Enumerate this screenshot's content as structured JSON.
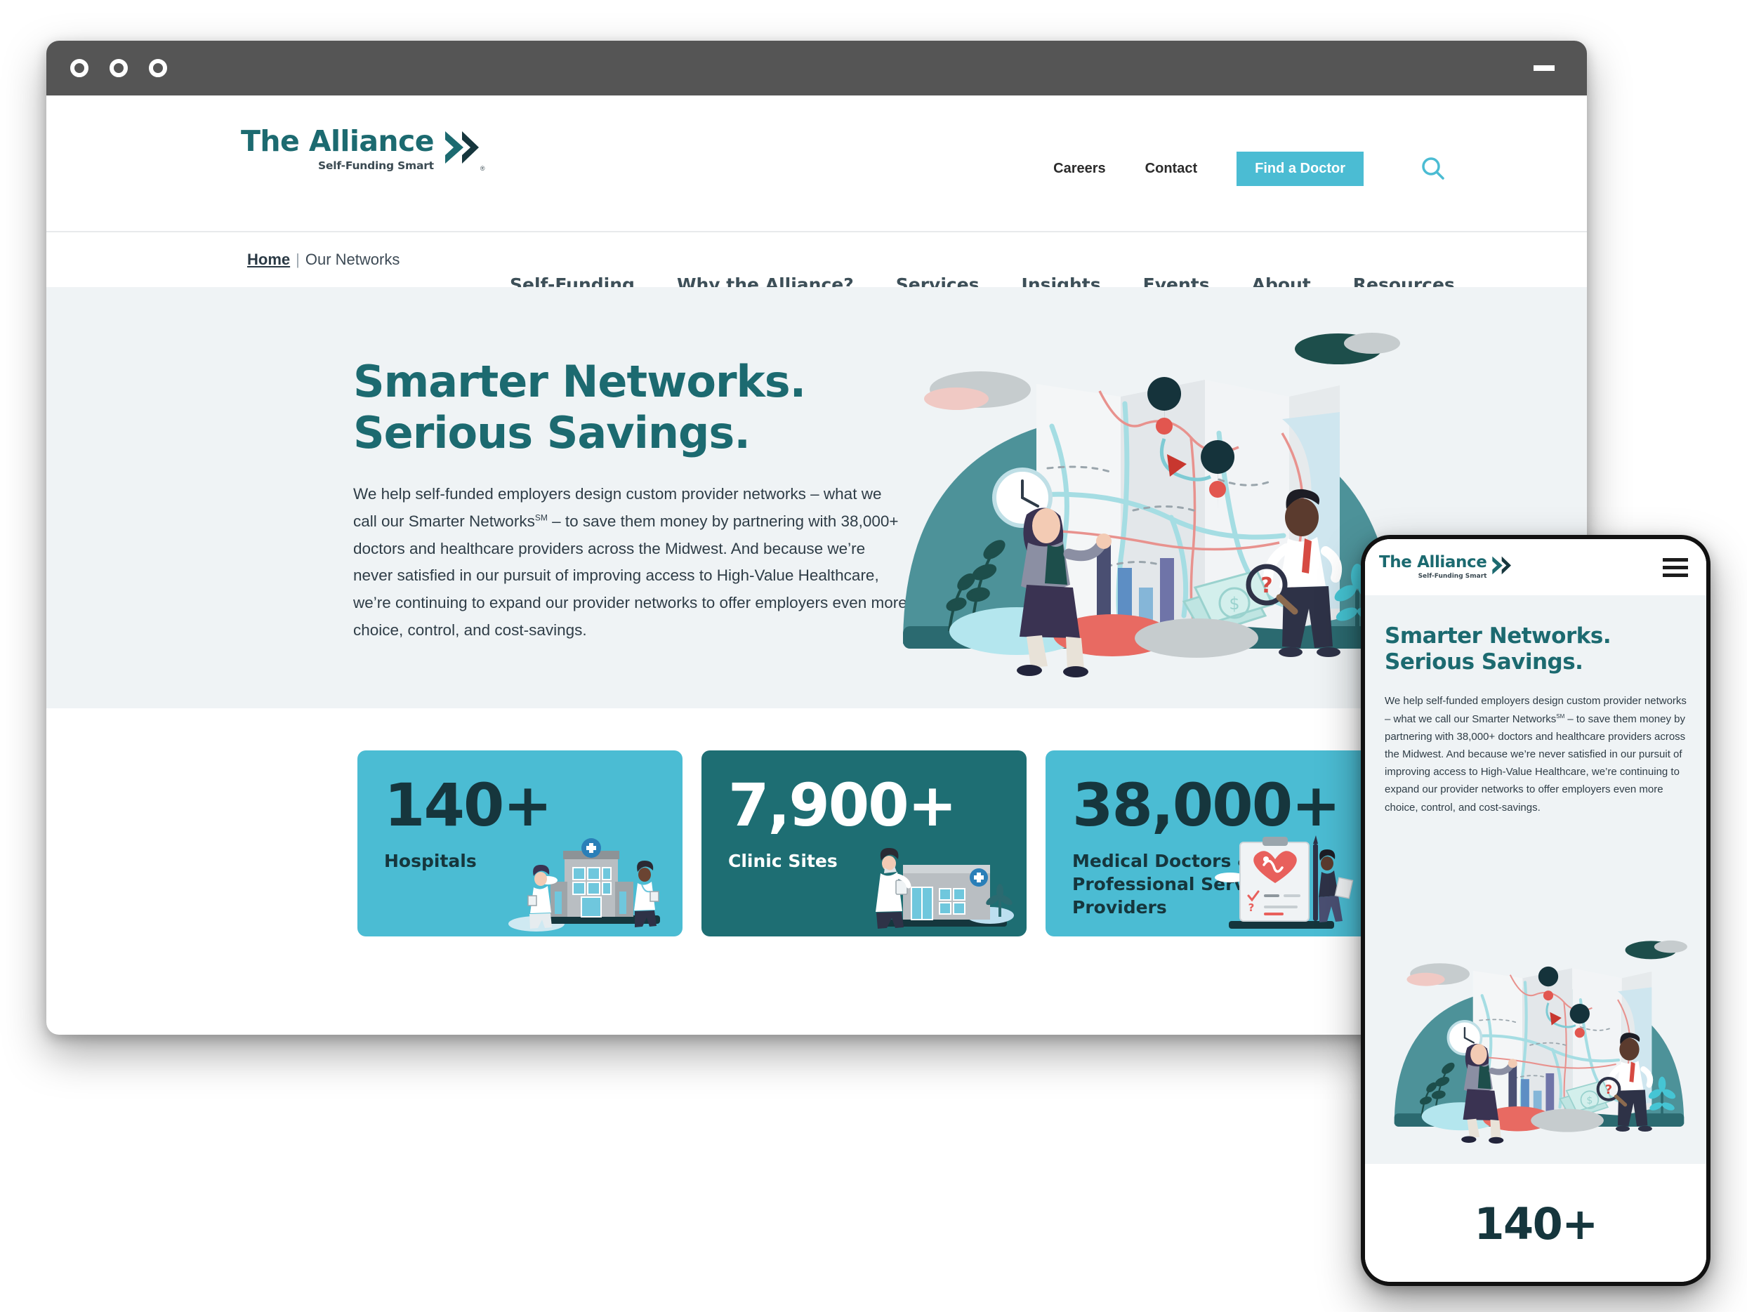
{
  "window": {
    "control_dots": [
      "dot-1",
      "dot-2",
      "dot-3"
    ],
    "minimize_label": "Minimize"
  },
  "brand": {
    "name": "The Alliance",
    "tagline": "Self-Funding Smart",
    "registered_mark": "®",
    "logo_color": "#1c6a70"
  },
  "utility_nav": {
    "links": [
      {
        "label": "Careers"
      },
      {
        "label": "Contact"
      }
    ],
    "cta_label": "Find a Doctor",
    "cta_color": "#4bbcd3",
    "search_icon": "search-icon"
  },
  "main_nav": {
    "items": [
      {
        "label": "Self-Funding"
      },
      {
        "label": "Why the Alliance?"
      },
      {
        "label": "Services"
      },
      {
        "label": "Insights"
      },
      {
        "label": "Events"
      },
      {
        "label": "About"
      },
      {
        "label": "Resources"
      }
    ]
  },
  "breadcrumb": {
    "home_label": "Home",
    "separator": "|",
    "current_label": "Our Networks"
  },
  "hero": {
    "title": "Smarter Networks. Serious Savings.",
    "paragraph_part1": "We help self-funded employers design custom provider networks – what we call our Smarter Networks",
    "paragraph_sup": "SM",
    "paragraph_part2": " – to save them money by partnering with 38,000+ doctors and healthcare providers across the Midwest. And because we’re never satisfied in our pursuit of improving access to High-Value Healthcare, we’re continuing to expand our provider networks to offer employers even more choice, control, and cost-savings.",
    "background_color": "#eff3f5",
    "illustration_name": "map-network-illustration"
  },
  "stats": {
    "cards": [
      {
        "number": "140+",
        "label": "Hospitals",
        "theme": "cyan",
        "background": "#4bbcd3",
        "art": "hospital-building-illustration"
      },
      {
        "number": "7,900+",
        "label": "Clinic Sites",
        "theme": "teal",
        "background": "#1e6e73",
        "art": "clinic-building-illustration"
      },
      {
        "number": "38,000+",
        "label": "Medical Doctors & Professional Service Providers",
        "theme": "cyan",
        "background": "#4bbcd3",
        "art": "clipboard-heart-illustration"
      }
    ]
  },
  "mobile": {
    "brand_name": "The Alliance",
    "brand_tagline": "Self-Funding Smart",
    "menu_icon": "hamburger-menu-icon",
    "title": "Smarter Networks. Serious Savings.",
    "paragraph_part1": "We help self-funded employers design custom provider networks – what we call our Smarter Networks",
    "paragraph_sup": "SM",
    "paragraph_part2": " – to save them money by partnering with 38,000+ doctors and healthcare providers across the Midwest. And because we’re never satisfied in our pursuit of improving access to High-Value Healthcare, we’re continuing to expand our provider networks to offer employers even more choice, control, and cost-savings.",
    "stat_number": "140+",
    "illustration_name": "map-network-illustration"
  }
}
